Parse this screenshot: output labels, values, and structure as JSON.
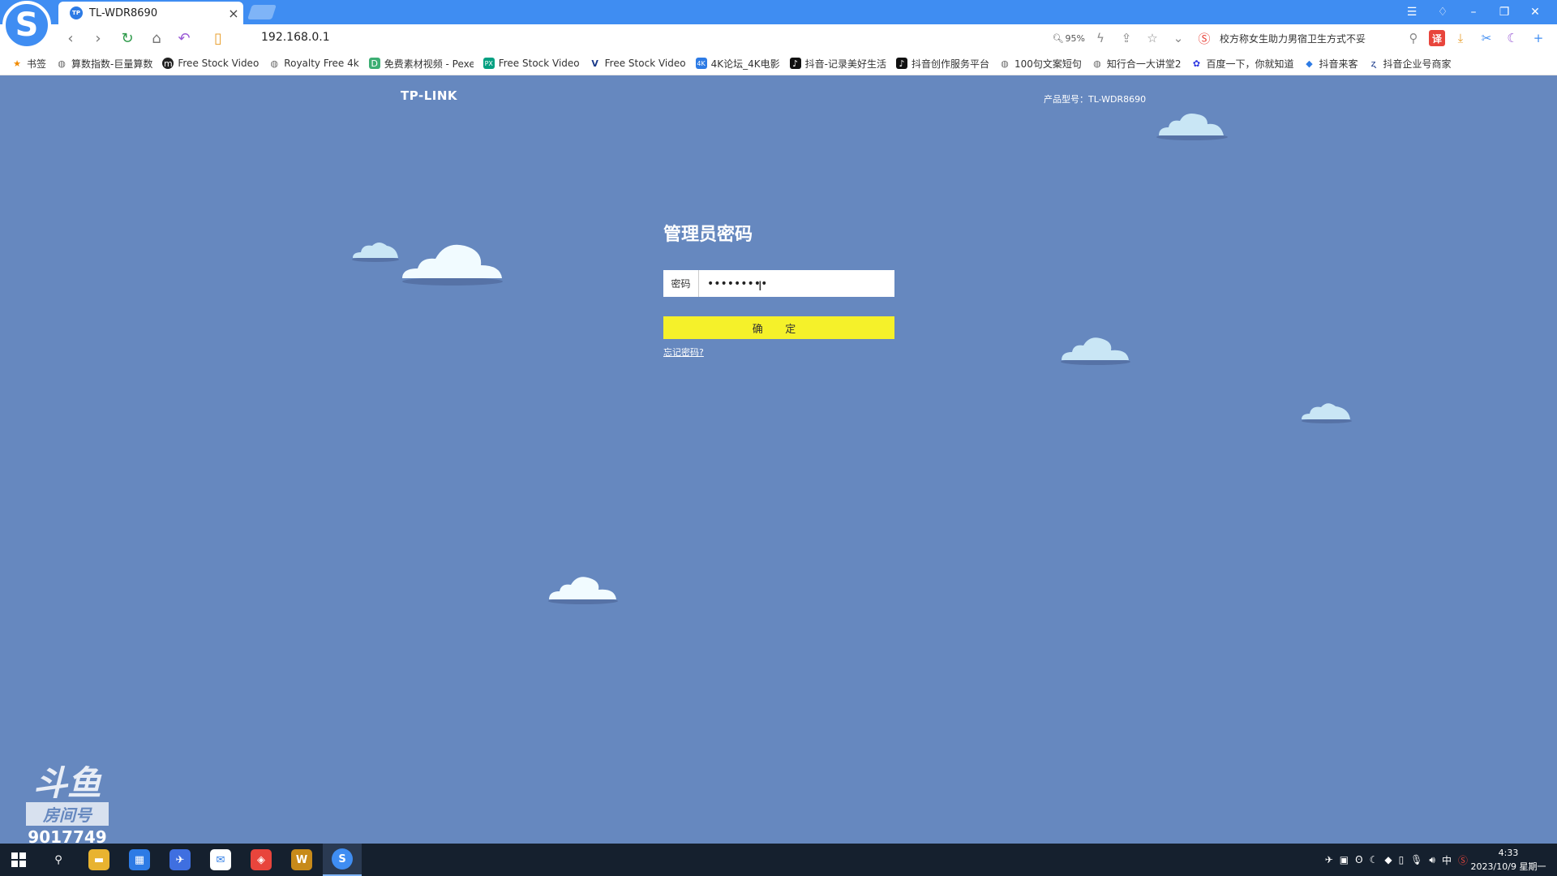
{
  "browser": {
    "tab_title": "TL-WDR8690",
    "tab_favicon": "TP",
    "url": "192.168.0.1",
    "zoom": "95%",
    "search_text": "校方称女生助力男宿卫生方式不妥",
    "logo_letter": "S"
  },
  "bookmarks": [
    {
      "label": "书签",
      "icon": "star-icon"
    },
    {
      "label": "算数指数-巨量算数",
      "icon": "globe-icon"
    },
    {
      "label": "Free Stock Video",
      "icon": "m-icon"
    },
    {
      "label": "Royalty Free 4k",
      "icon": "globe-icon"
    },
    {
      "label": "免费素材视频 - Pexels",
      "icon": "d-icon"
    },
    {
      "label": "Free Stock Video",
      "icon": "px-icon"
    },
    {
      "label": "Free Stock Video",
      "icon": "v-icon"
    },
    {
      "label": "4K论坛_4K电影",
      "icon": "4k-icon"
    },
    {
      "label": "抖音-记录美好生活",
      "icon": "tiktok-icon"
    },
    {
      "label": "抖音创作服务平台",
      "icon": "tiktok-icon"
    },
    {
      "label": "100句文案短句",
      "icon": "globe-icon"
    },
    {
      "label": "知行合一大讲堂2",
      "icon": "globe-icon"
    },
    {
      "label": "百度一下，你就知道",
      "icon": "paw-icon"
    },
    {
      "label": "抖音来客",
      "icon": "laike-icon"
    },
    {
      "label": "抖音企业号商家",
      "icon": "enterprise-icon"
    }
  ],
  "page": {
    "brand": "TP-LINK",
    "model_label": "产品型号：TL-WDR8690",
    "heading": "管理员密码",
    "password_label": "密码",
    "password_value": "•••••••••",
    "confirm_label": "确 定",
    "forgot_label": "忘记密码?"
  },
  "watermark": {
    "logo": "斗鱼",
    "room_label": "房间号",
    "room_number": "9017749"
  },
  "taskbar": {
    "time": "4:33",
    "date": "2023/10/9 星期一",
    "ime": "中"
  },
  "colors": {
    "page_bg": "#6688bf",
    "button_yellow": "#f5f12a",
    "titlebar_blue": "#3f8df2",
    "taskbar": "#15202e"
  }
}
